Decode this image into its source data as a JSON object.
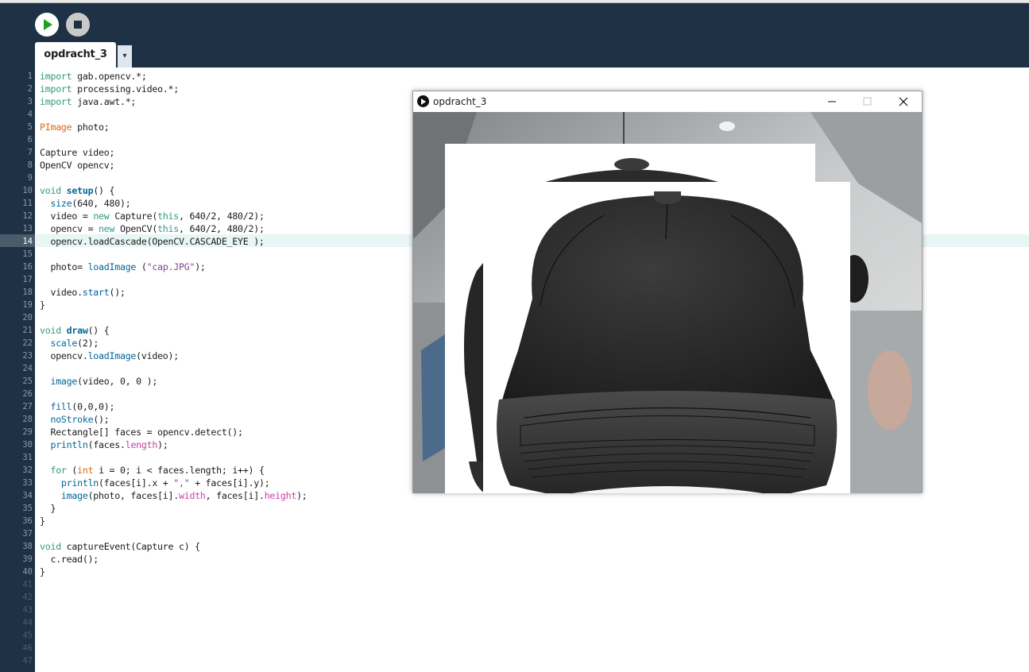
{
  "toolbar": {
    "run_label": "Run",
    "stop_label": "Stop",
    "tab_name": "opdracht_3",
    "tab_menu_glyph": "▾"
  },
  "editor": {
    "line_numbers": [
      "1",
      "2",
      "3",
      "4",
      "5",
      "6",
      "7",
      "8",
      "9",
      "10",
      "11",
      "12",
      "13",
      "14",
      "15",
      "16",
      "17",
      "18",
      "19",
      "20",
      "21",
      "22",
      "23",
      "24",
      "25",
      "26",
      "27",
      "28",
      "29",
      "30",
      "31",
      "32",
      "33",
      "34",
      "35",
      "36",
      "37",
      "38",
      "39",
      "40",
      "41",
      "42",
      "43",
      "44",
      "45",
      "46",
      "47"
    ],
    "highlighted_line": 14
  },
  "sketch_window": {
    "title": "opdracht_3",
    "icon": "processing-play-icon",
    "controls": [
      "minimize-icon",
      "maximize-icon",
      "close-icon"
    ]
  },
  "colors": {
    "toolbar_bg": "#1f3144",
    "keyword": "#33997e",
    "type": "#e2661a",
    "function": "#006699",
    "string": "#7d4793",
    "property": "#c63fa5",
    "run_icon": "#1ea11e"
  }
}
